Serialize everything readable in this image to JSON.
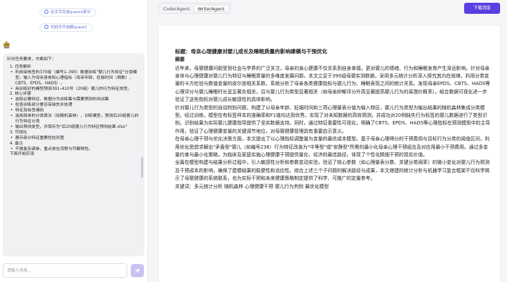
{
  "sidebar": {
    "chips": [
      "论文手完成quest1部分",
      "代码手开始解quest2"
    ],
    "message": {
      "intro": "针对任务要求，方案如下：",
      "items": [
        {
          "type": "sec",
          "text": "1. 任务解析"
        },
        {
          "type": "sub",
          "text": "利用审核签的370组（编号1–390）数据训练\"婴儿行为特征\"分类模型，输入为母亲身体和心理指标（母亲年龄、妊娠时间（周数）、CBTS、EPDS、HADS）。"
        },
        {
          "type": "sub",
          "text": "用训练好的模型预测391–410号（20组）婴儿的行为特征类型。"
        },
        {
          "type": "sec",
          "text": "2. 核心步骤"
        },
        {
          "type": "sub",
          "text": "选取必要特征、数据分为训练集与需要预测的测试集"
        },
        {
          "type": "sub",
          "text": "检查训练部分是否有缺失并处理"
        },
        {
          "type": "sub",
          "text": "特征及标签编码"
        },
        {
          "type": "sub",
          "text": "选用简单的分类算法（如随机森林），训练模型，预测后20组婴儿的行为特征分类"
        },
        {
          "type": "sub",
          "text": "输出预测类型，并保存为\"后20组婴儿行为特征预测结果.xlsx\""
        },
        {
          "type": "sec",
          "text": "3. 可视化"
        },
        {
          "type": "sub",
          "text": "展示部分特征重要性柱形图"
        },
        {
          "type": "sec",
          "text": "4. 备注"
        },
        {
          "type": "sub",
          "text": "不做复杂调参，重点放在流程与可解释性。"
        },
        {
          "type": "sec",
          "text": "下面开始实现"
        }
      ]
    },
    "input_placeholder": "请输入消息...",
    "send_icon": "send-icon"
  },
  "header": {
    "tabs": [
      "CoderAgent",
      "WriterAgent"
    ],
    "active_tab": "WriterAgent",
    "download_label": "下载消息"
  },
  "document": {
    "title": "标题：母亲心理健康对婴儿成长及睡眠质量的影响建模与干预优化",
    "abstract_heading": "摘要",
    "paragraphs": [
      "近年来，母婴健康问题受到社会与学界的广泛关注，母亲的身心健康不仅关系到自身幸福，更对婴儿的情绪、行为和睡眠发育产生深远影响。针对母亲身体与心理健康对婴儿行为特征与睡眠质量的多维度发展问题，本文立足于390组母婴实测数据，采用多元统计分析深入探究其内在规律。利用分类变量的卡方检验与数值变量的皮尔逊相关系数，系统分析了母亲各类健康指标与婴儿行为、睡眠表现之间的统计关系。发现母亲EPDS、CBTS、HADS等心理评分与婴儿睡眠时长呈显著负相关，且与婴儿行为类型显著相关（如母亲抑郁评分升高显著提高婴儿行为的易激价概率）。结合数据可视化进一步验证了这些指标对婴儿成长敏感性的具体影响。",
      "针对婴儿行为类型的自动判别问题，构建了以母亲年龄、妊娠时间和三项心理量表分值为输入特征，婴儿行为类型为输出结果的随机森林集成分类模型。经过训练，模型在有标签样本的准确率和F1值均达到优秀，实现了对未知数据的高效预测，并成功对20例缺失行为标签的婴儿数据进行了类型识别。识别结果为实际婴儿健康指导提供了坚实数据支持。同时，通过特征重要性可视化，明确了CBTS、EPDS、HADS等心理指标在预测模型中的主导作用，验证了心理健康变量的关键调节地位，对母婴健康管理具有重要启示意义。",
      "在母亲心理干预与优化决策方面，本文提出了以心理指标调整量为变量的最优成本模型。基于母亲心理得分的干预费用与目标行为分类的阈值区间，利用优化思想求解出\"矛盾型\"婴儿（如编号238）行为特征改善为\"中等型\"或\"安静型\"所需的最小化母亲心理干预组合及对应用最小干预费用。通过多变量约束与最小化策略，为临床及家庭实施心理健康干预提供量化、经济的最佳路径，体现了个性化精细干预的现实价值。",
      "全篇在模型构建与结果分析过程中，引入敏感性分析和参数变动实验，验证了核心参数（如心理量表分数、关键分类阈率）的微小变化对婴儿行为预测及干预成本的影响，确保了建模结果的稳健性和适应性。综合上述三个子问题的解决路径与成果，本文搭建的统计分析与机器学习复合框架不仅科学揭示了母婴健康的系统联系，也为实际干预和未来健康策略制定提供了科学、可推广的定量参考。"
    ],
    "keywords": "关键词：多元统计分析   随机森林   心理健康干预   婴儿行为判别   最优化模型"
  }
}
